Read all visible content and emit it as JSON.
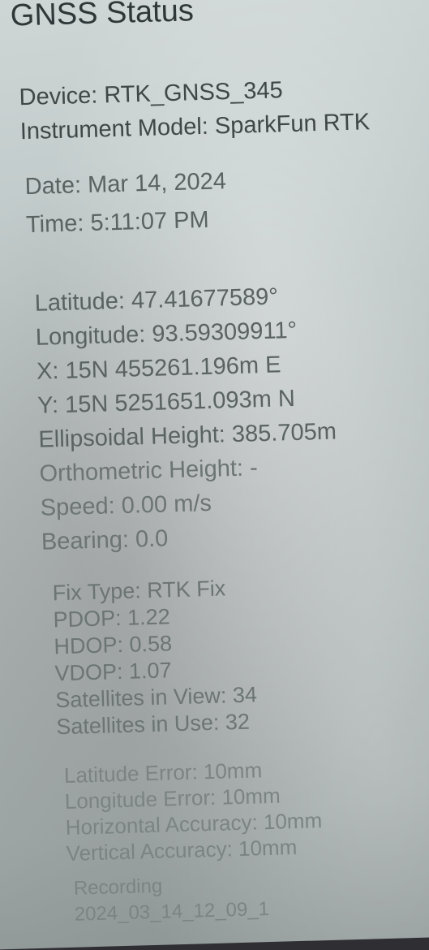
{
  "title": "GNSS Status",
  "device": {
    "name_line": "Device: RTK_GNSS_345",
    "model_line": "Instrument Model: SparkFun RTK"
  },
  "datetime": {
    "date_line": "Date: Mar 14, 2024",
    "time_line": "Time: 5:11:07 PM"
  },
  "position": {
    "latitude": "Latitude: 47.41677589°",
    "longitude": "Longitude: 93.59309911°",
    "x": "X: 15N 455261.196m E",
    "y": "Y: 15N 5251651.093m N",
    "ellipsoidal_height": "Ellipsoidal Height: 385.705m",
    "orthometric_height": "Orthometric Height: -",
    "speed": "Speed: 0.00 m/s",
    "bearing": "Bearing: 0.0"
  },
  "fix": {
    "fix_type": "Fix Type: RTK Fix",
    "pdop": "PDOP: 1.22",
    "hdop": "HDOP: 0.58",
    "vdop": "VDOP: 1.07",
    "sats_in_view": "Satellites in View: 34",
    "sats_in_use": "Satellites in Use: 32"
  },
  "accuracy": {
    "lat_error": "Latitude Error: 10mm",
    "lon_error": "Longitude Error: 10mm",
    "horizontal": "Horizontal Accuracy: 10mm",
    "vertical": "Vertical Accuracy: 10mm"
  },
  "recording": {
    "label": "Recording",
    "file": "2024_03_14_12_09_1"
  }
}
